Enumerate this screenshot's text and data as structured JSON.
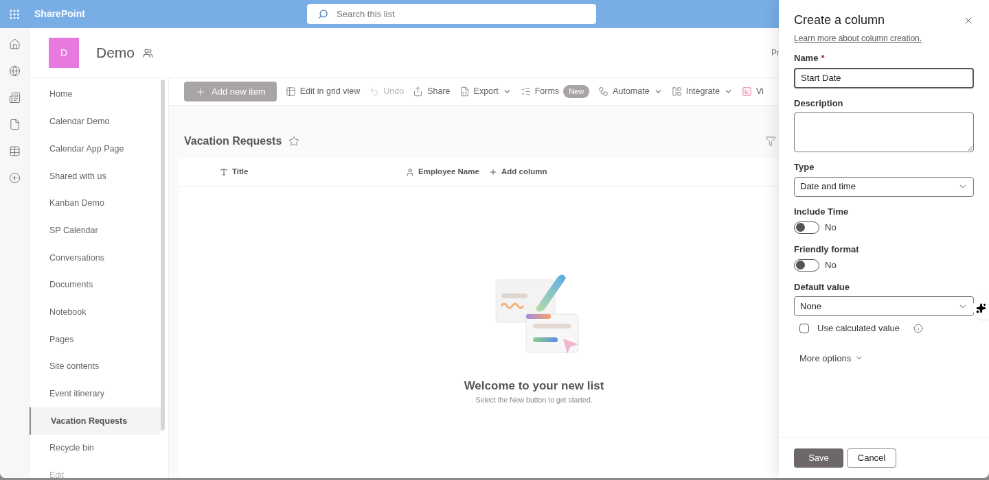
{
  "top_bar": {
    "app_name": "SharePoint",
    "search": {
      "placeholder": "Search this list"
    }
  },
  "site": {
    "logo_letter": "D",
    "title": "Demo",
    "header_right": "Pr"
  },
  "nav": {
    "items": [
      {
        "label": "Home",
        "selected": false
      },
      {
        "label": "Calendar Demo",
        "selected": false
      },
      {
        "label": "Calendar App Page",
        "selected": false
      },
      {
        "label": "Shared with us",
        "selected": false
      },
      {
        "label": "Kanban Demo",
        "selected": false
      },
      {
        "label": "SP Calendar",
        "selected": false
      },
      {
        "label": "Conversations",
        "selected": false
      },
      {
        "label": "Documents",
        "selected": false
      },
      {
        "label": "Notebook",
        "selected": false
      },
      {
        "label": "Pages",
        "selected": false
      },
      {
        "label": "Site contents",
        "selected": false
      },
      {
        "label": "Event itinerary",
        "selected": false
      },
      {
        "label": "Vacation Requests",
        "selected": true
      },
      {
        "label": "Recycle bin",
        "selected": false
      },
      {
        "label": "Edit",
        "selected": false
      }
    ]
  },
  "toolbar": [
    {
      "kind": "add",
      "label": "Add new item",
      "disabled": false,
      "dropdown": false
    },
    {
      "kind": "grid",
      "label": "Edit in grid view",
      "disabled": false,
      "dropdown": false
    },
    {
      "kind": "undo",
      "label": "Undo",
      "disabled": true,
      "dropdown": false
    },
    {
      "kind": "share",
      "label": "Share",
      "disabled": false,
      "dropdown": false
    },
    {
      "kind": "export",
      "label": "Export",
      "disabled": false,
      "dropdown": true
    },
    {
      "kind": "forms",
      "label": "Forms",
      "badge": "New",
      "disabled": false,
      "dropdown": false
    },
    {
      "kind": "automate",
      "label": "Automate",
      "disabled": false,
      "dropdown": true
    },
    {
      "kind": "integrate",
      "label": "Integrate",
      "disabled": false,
      "dropdown": true
    },
    {
      "kind": "view",
      "label": "Vi",
      "disabled": false,
      "dropdown": false
    }
  ],
  "list": {
    "title": "Vacation Requests",
    "favorite": false,
    "columns": [
      {
        "kind": "text",
        "label": "Title"
      },
      {
        "kind": "person",
        "label": "Employee Name"
      },
      {
        "kind": "add",
        "label": "Add column"
      }
    ],
    "empty": {
      "heading": "Welcome to your new list",
      "subtext": "Select the New button to get started."
    }
  },
  "panel": {
    "title": "Create a column",
    "required_mark": "*",
    "link": "Learn more about column creation.",
    "fields": [
      {
        "kind": "text",
        "label": "Name",
        "required": true,
        "value": "Start Date"
      },
      {
        "kind": "textarea",
        "label": "Description",
        "required": false
      },
      {
        "kind": "select",
        "label": "Type",
        "required": false,
        "value": "Date and time"
      },
      {
        "kind": "toggle",
        "label": "Include Time",
        "on": false,
        "state_text": "No"
      },
      {
        "kind": "toggle",
        "label": "Friendly format",
        "on": false,
        "state_text": "No"
      },
      {
        "kind": "select",
        "label": "Default value",
        "required": false,
        "value": "None"
      },
      {
        "kind": "checkbox",
        "label": "Use calculated value",
        "checked": false
      }
    ],
    "more_options": "More options",
    "buttons": [
      {
        "label": "Save",
        "primary": true
      },
      {
        "label": "Cancel",
        "primary": false
      }
    ]
  }
}
